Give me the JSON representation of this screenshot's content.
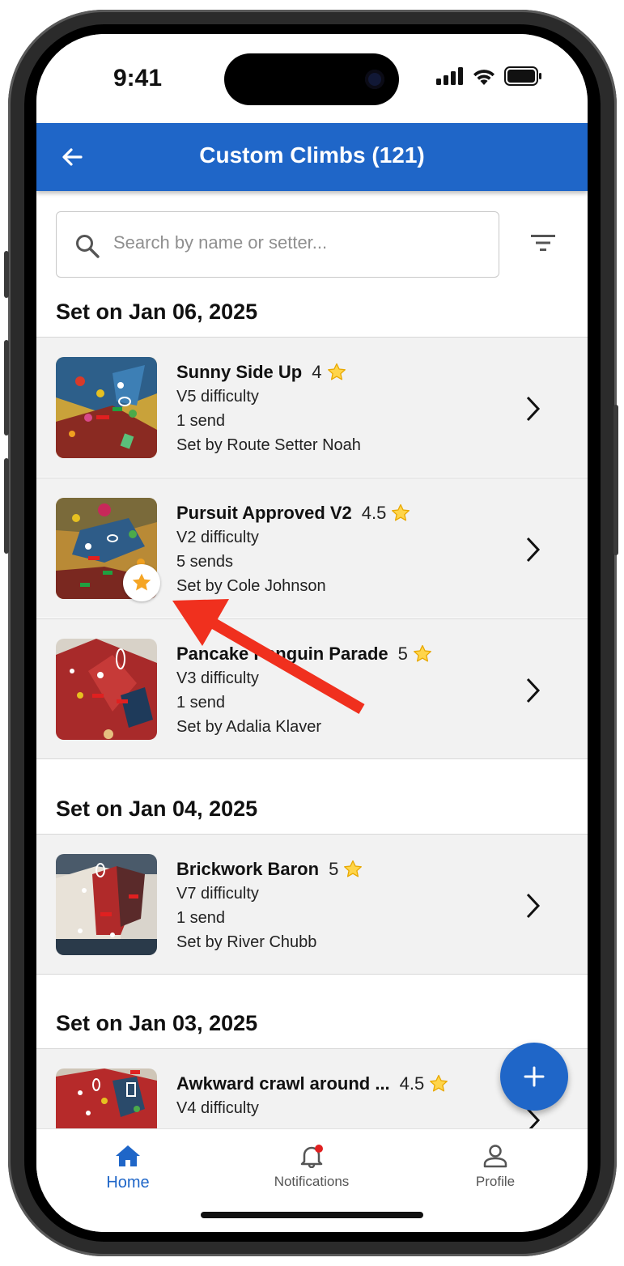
{
  "status_bar": {
    "time": "9:41"
  },
  "app_bar": {
    "title": "Custom Climbs (121)"
  },
  "search": {
    "placeholder": "Search by name or setter..."
  },
  "sections": [
    {
      "title": "Set on Jan 06, 2025",
      "climbs": [
        {
          "name": "Sunny Side Up",
          "rating": "4",
          "difficulty": "V5 difficulty",
          "sends": "1 send",
          "setter": "Set by Route Setter Noah",
          "favorited": false
        },
        {
          "name": "Pursuit Approved V2",
          "rating": "4.5",
          "difficulty": "V2 difficulty",
          "sends": "5 sends",
          "setter": "Set by Cole Johnson",
          "favorited": true
        },
        {
          "name": "Pancake Penguin Parade",
          "rating": "5",
          "difficulty": "V3 difficulty",
          "sends": "1 send",
          "setter": "Set by Adalia Klaver",
          "favorited": false
        }
      ]
    },
    {
      "title": "Set on Jan 04, 2025",
      "climbs": [
        {
          "name": "Brickwork Baron",
          "rating": "5",
          "difficulty": "V7 difficulty",
          "sends": "1 send",
          "setter": "Set by River Chubb",
          "favorited": false
        }
      ]
    },
    {
      "title": "Set on Jan 03, 2025",
      "climbs": [
        {
          "name": "Awkward crawl around ...",
          "rating": "4.5",
          "difficulty": "V4 difficulty",
          "sends": "",
          "setter": "",
          "favorited": false
        }
      ]
    }
  ],
  "bottom_nav": {
    "items": [
      {
        "label": "Home",
        "icon": "home-icon",
        "active": true
      },
      {
        "label": "Notifications",
        "icon": "bell-icon",
        "active": false
      },
      {
        "label": "Profile",
        "icon": "person-icon",
        "active": false
      }
    ]
  },
  "colors": {
    "primary": "#1f66c8",
    "annotation_arrow": "#f0301e",
    "favorite_star": "#f5a524"
  }
}
